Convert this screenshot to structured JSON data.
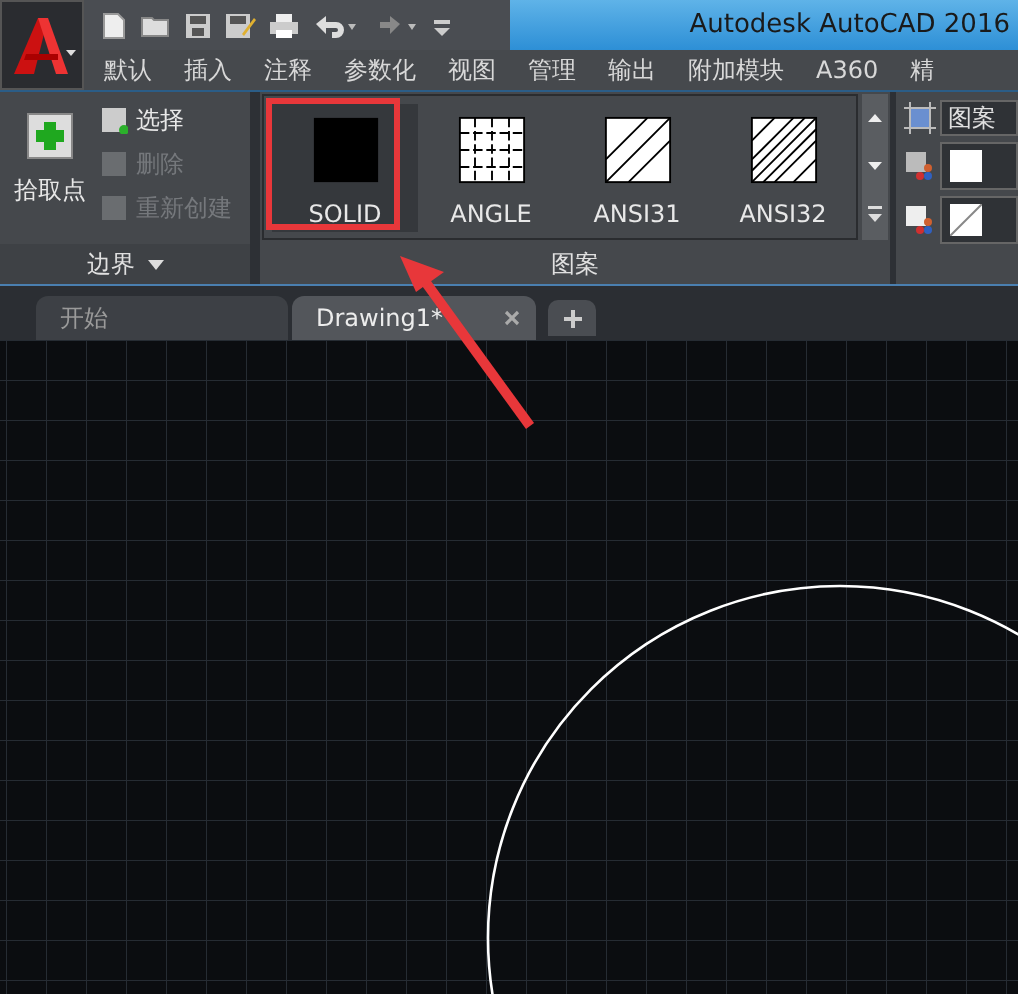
{
  "window": {
    "title": "Autodesk AutoCAD 2016"
  },
  "ribbon_tabs": [
    {
      "label": "默认"
    },
    {
      "label": "插入"
    },
    {
      "label": "注释"
    },
    {
      "label": "参数化"
    },
    {
      "label": "视图"
    },
    {
      "label": "管理"
    },
    {
      "label": "输出"
    },
    {
      "label": "附加模块"
    },
    {
      "label": "A360"
    },
    {
      "label": "精"
    }
  ],
  "boundary_panel": {
    "title": "边界",
    "pick_points": "拾取点",
    "items": [
      {
        "label": "选择",
        "disabled": false
      },
      {
        "label": "删除",
        "disabled": true
      },
      {
        "label": "重新创建",
        "disabled": true
      }
    ]
  },
  "pattern_panel": {
    "title": "图案",
    "patterns": [
      {
        "label": "SOLID",
        "kind": "solid",
        "selected": true
      },
      {
        "label": "ANGLE",
        "kind": "grid",
        "selected": false
      },
      {
        "label": "ANSI31",
        "kind": "wide",
        "selected": false
      },
      {
        "label": "ANSI32",
        "kind": "dense",
        "selected": false
      }
    ]
  },
  "properties_panel": {
    "type_value": "图案"
  },
  "document_tabs": [
    {
      "label": "开始",
      "selected": false
    },
    {
      "label": "Drawing1*",
      "selected": true
    }
  ]
}
